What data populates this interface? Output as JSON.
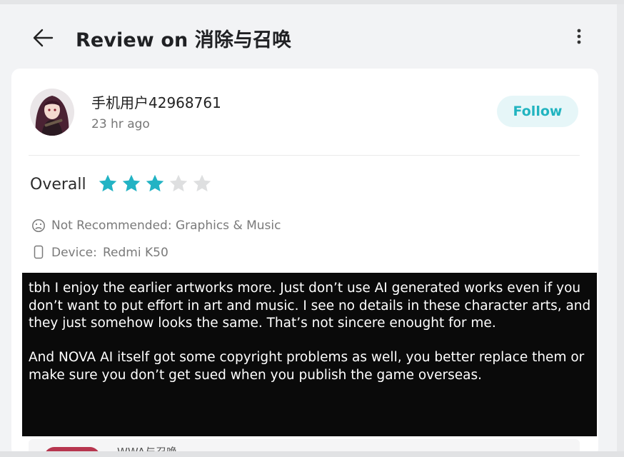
{
  "header": {
    "title": "Review on 消除与召唤",
    "back_icon": "arrow-left-icon",
    "more_icon": "more-vertical-icon"
  },
  "review": {
    "author": {
      "name": "手机用户42968761",
      "posted": "23 hr ago",
      "avatar": "anime-character-avatar"
    },
    "follow_label": "Follow",
    "overall_label": "Overall",
    "rating": {
      "value": 3,
      "max": 5
    },
    "not_recommended": "Not Recommended: Graphics & Music",
    "device_label": "Device:",
    "device_value": "Redmi K50",
    "body": [
      "tbh I enjoy the earlier artworks more. Just don’t use AI generated works even if you don’t want to put effort in art and music. I see no details in these character arts, and they just somehow looks the same.  That’s not sincere enought for me.",
      "And NOVA AI itself got some copyright problems as well, you better replace them or make sure you don’t get sued when you publish the game overseas."
    ]
  },
  "next_item": {
    "text": "WWA与召唤"
  },
  "colors": {
    "accent": "#21b4c0",
    "star_filled": "#22b3c4",
    "star_empty": "#dedfe0",
    "follow_bg": "#e6f6f8",
    "review_box_bg": "#0a0a0a"
  }
}
